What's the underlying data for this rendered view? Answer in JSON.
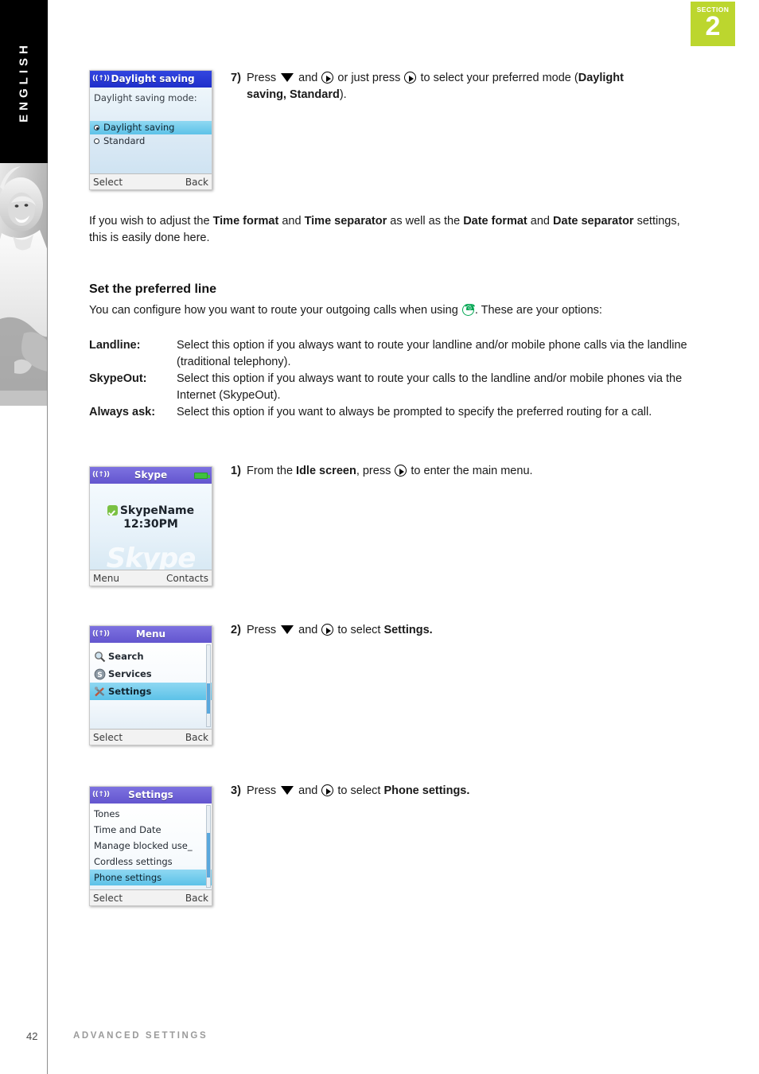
{
  "sidebar": {
    "language_tab": "ENGLISH",
    "photo_alt": "woman-photo"
  },
  "section_badge": {
    "label": "SECTION",
    "number": "2",
    "color": "#bcd62e"
  },
  "steps": {
    "step7": {
      "number": "7)",
      "text_1": "Press",
      "text_2": "and",
      "text_3": "or just press",
      "text_4": "to select your preferred mode (",
      "bold_1": "Daylight",
      "bold_2": "saving, Standard",
      "text_5": ")."
    },
    "step1": {
      "number": "1)",
      "text_1": "From the",
      "bold_1": "Idle screen",
      "text_2": ", press",
      "text_3": "to enter the main menu."
    },
    "step2": {
      "number": "2)",
      "text_1": "Press",
      "text_2": "and",
      "text_3": "to select",
      "bold_1": "Settings."
    },
    "step3": {
      "number": "3)",
      "text_1": "Press",
      "text_2": "and",
      "text_3": "to select",
      "bold_1": "Phone settings."
    }
  },
  "paragraphs": {
    "time_format_note": {
      "text_1": "If you wish to adjust the",
      "bold_1": "Time format",
      "text_2": "and",
      "bold_2": "Time separator",
      "text_3": "as well as the",
      "bold_3": "Date format",
      "text_4": "and",
      "bold_4": "Date separator",
      "text_5": "settings, this is easily done here."
    }
  },
  "preferred_line": {
    "heading": "Set the preferred line",
    "intro_1": "You can configure how you want to route your outgoing calls when using",
    "intro_2": ". These are your options:",
    "options": [
      {
        "term": "Landline:",
        "desc": "Select this option if you always want to route your landline and/or mobile phone calls via the landline (traditional telephony)."
      },
      {
        "term": "SkypeOut:",
        "desc": "Select this option if you always want to route your calls to the landline and/or mobile phones via the Internet (SkypeOut)."
      },
      {
        "term": "Always ask:",
        "desc": "Select this option if you want to always be prompted to specify the preferred routing for a call."
      }
    ]
  },
  "phone_screens": {
    "daylight_saving": {
      "title": "Daylight saving",
      "signal_icon": "((↑))",
      "prompt": "Daylight saving mode:",
      "options": [
        {
          "label": "Daylight saving",
          "selected": true
        },
        {
          "label": "Standard",
          "selected": false
        }
      ],
      "softkey_left": "Select",
      "softkey_right": "Back"
    },
    "idle": {
      "title": "Skype",
      "signal_icon": "((↑))",
      "battery_icon": "battery-icon",
      "user_name": "SkypeName",
      "time": "12:30PM",
      "watermark": "Skype",
      "softkey_left": "Menu",
      "softkey_right": "Contacts"
    },
    "menu": {
      "title": "Menu",
      "signal_icon": "((↑))",
      "items": [
        {
          "label": "Search",
          "icon": "magnifier-icon",
          "selected": false
        },
        {
          "label": "Services",
          "icon": "skype-s-icon",
          "selected": false
        },
        {
          "label": "Settings",
          "icon": "tools-icon",
          "selected": true
        }
      ],
      "softkey_left": "Select",
      "softkey_right": "Back"
    },
    "settings": {
      "title": "Settings",
      "signal_icon": "((↑))",
      "items": [
        {
          "label": "Tones",
          "selected": false
        },
        {
          "label": "Time and Date",
          "selected": false
        },
        {
          "label": "Manage blocked use_",
          "selected": false
        },
        {
          "label": "Cordless settings",
          "selected": false
        },
        {
          "label": "Phone settings",
          "selected": true
        }
      ],
      "softkey_left": "Select",
      "softkey_right": "Back"
    }
  },
  "footer": {
    "page_number": "42",
    "chapter": "ADVANCED SETTINGS"
  }
}
